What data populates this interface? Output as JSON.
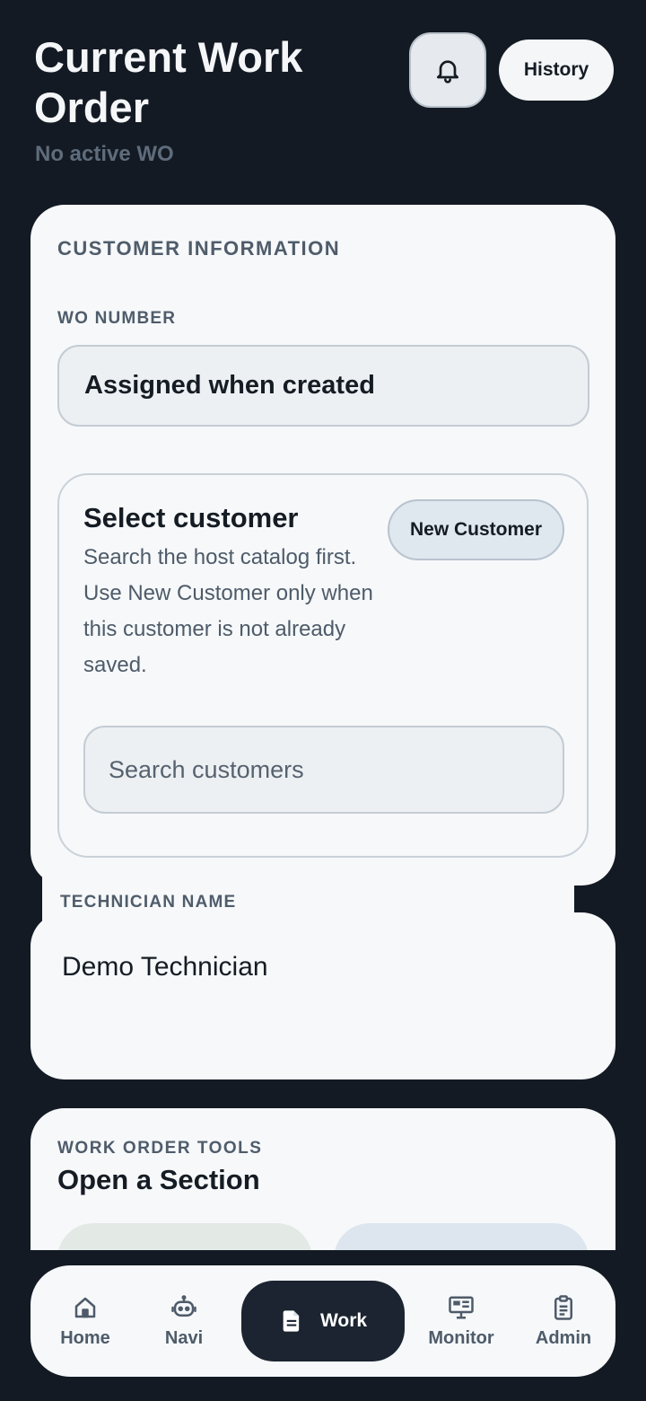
{
  "header": {
    "title": "Current Work Order",
    "subtitle": "No active WO",
    "history_label": "History"
  },
  "customer_info": {
    "section_label": "CUSTOMER INFORMATION",
    "wo_number_label": "WO NUMBER",
    "wo_number_value": "Assigned when created",
    "select_title": "Select customer",
    "select_description": "Search the host catalog first. Use New Customer only when this customer is not already saved.",
    "new_customer_label": "New Customer",
    "search_placeholder": "Search customers"
  },
  "technician": {
    "label": "TECHNICIAN NAME",
    "value": "Demo Technician"
  },
  "tools": {
    "label": "WORK ORDER TOOLS",
    "title": "Open a Section"
  },
  "nav": {
    "home": "Home",
    "navi": "Navi",
    "work": "Work",
    "monitor": "Monitor",
    "admin": "Admin"
  },
  "icons": {
    "bell": "bell-icon",
    "home": "home-icon",
    "navi": "robot-icon",
    "work": "document-icon",
    "monitor": "monitor-icon",
    "admin": "clipboard-icon"
  },
  "colors": {
    "background": "#131a23",
    "card": "#f6f8fa",
    "active_nav": "#1b2430",
    "muted_text": "#4e5b69"
  }
}
